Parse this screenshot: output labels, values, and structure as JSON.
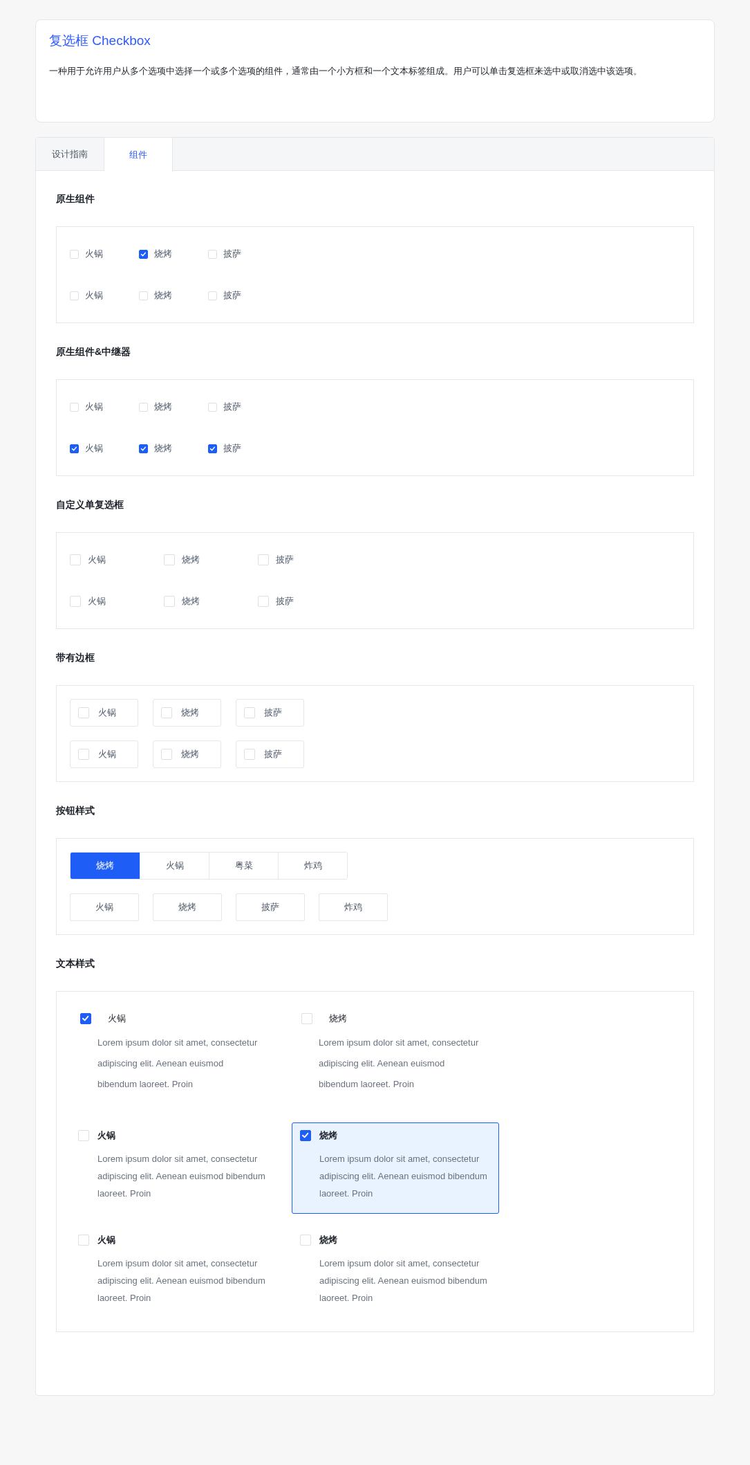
{
  "header": {
    "title": "复选框 Checkbox",
    "description": "一种用于允许用户从多个选项中选择一个或多个选项的组件，通常由一个小方框和一个文本标签组成。用户可以单击复选框来选中或取消选中该选项。"
  },
  "tabs": [
    {
      "label": "设计指南",
      "selected": false
    },
    {
      "label": "组件",
      "selected": true
    }
  ],
  "sections": [
    {
      "title": "原生组件",
      "rows": [
        {
          "kind": "native",
          "items": [
            {
              "label": "火锅",
              "checked": false
            },
            {
              "label": "烧烤",
              "checked": true
            },
            {
              "label": "披萨",
              "checked": false
            }
          ]
        },
        {
          "kind": "native",
          "items": [
            {
              "label": "火锅",
              "checked": false
            },
            {
              "label": "烧烤",
              "checked": false
            },
            {
              "label": "披萨",
              "checked": false
            }
          ]
        }
      ]
    },
    {
      "title": "原生组件&中继器",
      "rows": [
        {
          "kind": "native",
          "items": [
            {
              "label": "火锅",
              "checked": false
            },
            {
              "label": "烧烤",
              "checked": false
            },
            {
              "label": "披萨",
              "checked": false
            }
          ]
        },
        {
          "kind": "native",
          "items": [
            {
              "label": "火锅",
              "checked": true
            },
            {
              "label": "烧烤",
              "checked": true
            },
            {
              "label": "披萨",
              "checked": true
            }
          ]
        }
      ]
    },
    {
      "title": "自定义单复选框",
      "rows": [
        {
          "kind": "custom",
          "items": [
            {
              "label": "火锅",
              "checked": false
            },
            {
              "label": "烧烤",
              "checked": false
            },
            {
              "label": "披萨",
              "checked": false
            }
          ]
        },
        {
          "kind": "custom",
          "items": [
            {
              "label": "火锅",
              "checked": false
            },
            {
              "label": "烧烤",
              "checked": false
            },
            {
              "label": "披萨",
              "checked": false
            }
          ]
        }
      ]
    },
    {
      "title": "带有边框",
      "rows": [
        {
          "kind": "bordered",
          "items": [
            {
              "label": "火锅",
              "checked": false
            },
            {
              "label": "烧烤",
              "checked": false
            },
            {
              "label": "披萨",
              "checked": false
            }
          ]
        },
        {
          "kind": "bordered",
          "items": [
            {
              "label": "火锅",
              "checked": false
            },
            {
              "label": "烧烤",
              "checked": false
            },
            {
              "label": "披萨",
              "checked": false
            }
          ]
        }
      ]
    },
    {
      "title": "按钮样式",
      "rows": [
        {
          "kind": "segmented",
          "items": [
            {
              "label": "烧烤",
              "selected": true
            },
            {
              "label": "火锅",
              "selected": false
            },
            {
              "label": "粤菜",
              "selected": false
            },
            {
              "label": "炸鸡",
              "selected": false
            }
          ]
        },
        {
          "kind": "separate",
          "items": [
            {
              "label": "火锅",
              "selected": false
            },
            {
              "label": "烧烤",
              "selected": false
            },
            {
              "label": "披萨",
              "selected": false
            },
            {
              "label": "炸鸡",
              "selected": false
            }
          ]
        }
      ]
    },
    {
      "title": "文本样式",
      "rows": [
        {
          "kind": "plain",
          "items": [
            {
              "label": "火锅",
              "checked": true,
              "description": "Lorem ipsum dolor sit amet, consectetur adipiscing elit. Aenean euismod bibendum laoreet. Proin"
            },
            {
              "label": "烧烤",
              "checked": false,
              "description": "Lorem ipsum dolor sit amet, consectetur adipiscing elit. Aenean euismod bibendum laoreet. Proin"
            }
          ]
        },
        {
          "kind": "card",
          "items": [
            {
              "label": "火锅",
              "checked": false,
              "description": "Lorem ipsum dolor sit amet, consectetur adipiscing elit. Aenean euismod bibendum laoreet. Proin"
            },
            {
              "label": "烧烤",
              "checked": true,
              "description": "Lorem ipsum dolor sit amet, consectetur adipiscing elit. Aenean euismod bibendum laoreet. Proin"
            }
          ]
        },
        {
          "kind": "card",
          "items": [
            {
              "label": "火锅",
              "checked": false,
              "description": "Lorem ipsum dolor sit amet, consectetur adipiscing elit. Aenean euismod bibendum laoreet. Proin"
            },
            {
              "label": "烧烤",
              "checked": false,
              "description": "Lorem ipsum dolor sit amet, consectetur adipiscing elit. Aenean euismod bibendum laoreet. Proin"
            }
          ]
        }
      ]
    }
  ]
}
